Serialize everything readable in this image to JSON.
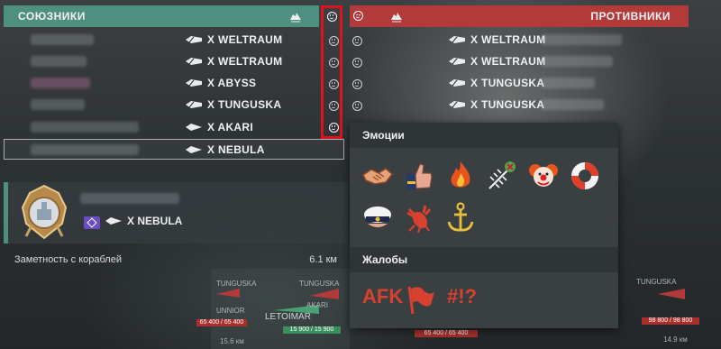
{
  "allies": {
    "title": "СОЮЗНИКИ",
    "players": [
      {
        "ship": "X WELTRAUM"
      },
      {
        "ship": "X WELTRAUM"
      },
      {
        "ship": "X ABYSS"
      },
      {
        "ship": "X TUNGUSKA"
      },
      {
        "ship": "X AKARI"
      },
      {
        "ship": "X NEBULA"
      }
    ]
  },
  "enemies": {
    "title": "ПРОТИВНИКИ",
    "players": [
      {
        "ship": "X WELTRAUM"
      },
      {
        "ship": "X WELTRAUM"
      },
      {
        "ship": "X TUNGUSKA"
      },
      {
        "ship": "X TUNGUSKA"
      }
    ]
  },
  "player_card": {
    "ship": "X NEBULA",
    "detect_label": "Заметность с кораблей",
    "detect_value": "6.1 км"
  },
  "scene": {
    "labels": [
      "TUNGUSKA",
      "UNNIOR",
      "TUNGUSKA",
      "AKARI",
      "LETOIMAR"
    ],
    "hp_left": "65 400 / 65 400",
    "hp_mid": "15 900 / 15 900",
    "hp_mid2": "65 400 / 65 400",
    "hp_right": "98 800 / 98 800",
    "dist_left": "15.6 км",
    "dist_right": "14.9 км",
    "right_name": "TUNGUSKA"
  },
  "popup": {
    "emotions_title": "Эмоции",
    "complaints_title": "Жалобы",
    "emotions": [
      "handshake",
      "thumbs-up",
      "fire",
      "fish-skeleton",
      "clown",
      "lifebuoy",
      "captain-hat",
      "lobster",
      "anchor"
    ],
    "complaints": [
      "AFK",
      "flag",
      "#!?"
    ]
  },
  "colors": {
    "ally": "#4e8f80",
    "enemy": "#b23a3a",
    "highlight": "#e0121b",
    "complaint": "#d8412f"
  }
}
